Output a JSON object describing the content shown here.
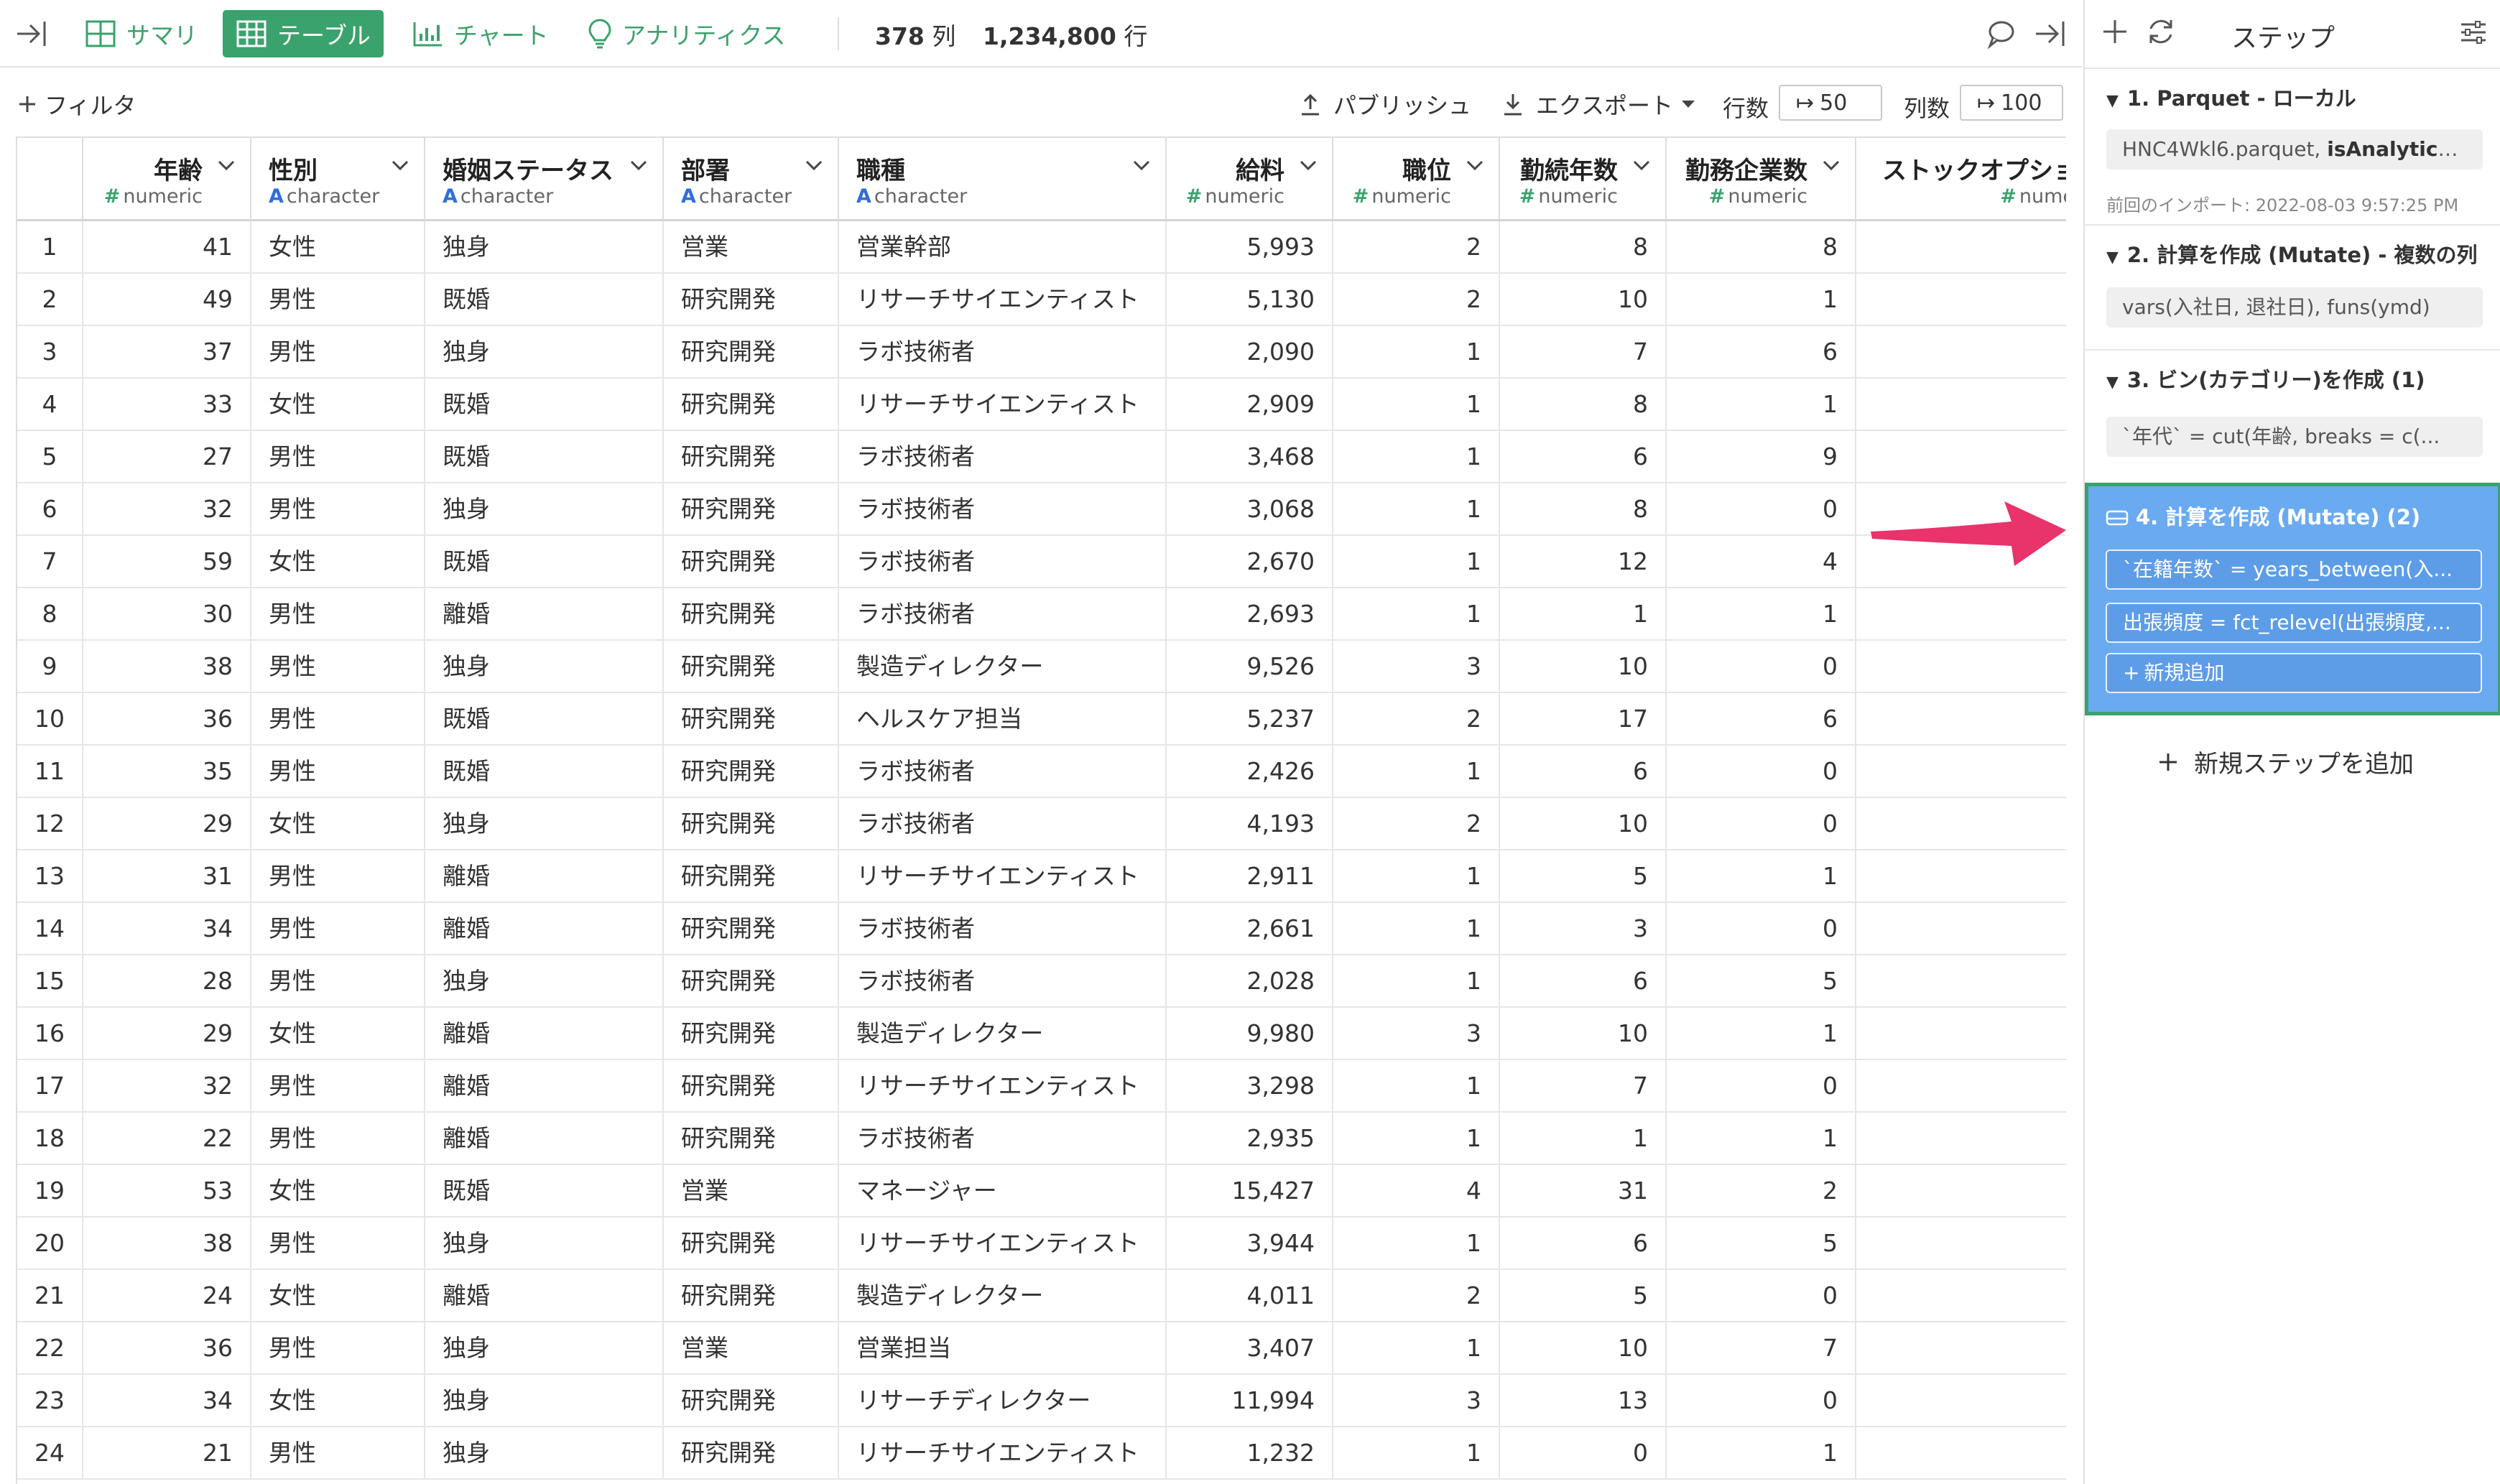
{
  "toolbar": {
    "tabs": [
      {
        "label": "サマリ",
        "icon": "summary-grid-icon",
        "active": false
      },
      {
        "label": "テーブル",
        "icon": "table-icon",
        "active": true
      },
      {
        "label": "チャート",
        "icon": "bar-chart-icon",
        "active": false
      },
      {
        "label": "アナリティクス",
        "icon": "lightbulb-icon",
        "active": false
      }
    ],
    "columns_count": "378",
    "columns_unit": "列",
    "rows_count": "1,234,800",
    "rows_unit": "行"
  },
  "subbar": {
    "filter_label": "フィルタ",
    "publish_label": "パブリッシュ",
    "export_label": "エクスポート",
    "rows_label": "行数",
    "rows_value": "50",
    "cols_label": "列数",
    "cols_value": "100"
  },
  "table": {
    "columns": [
      {
        "name": "年齢",
        "type": "numeric",
        "kind": "num"
      },
      {
        "name": "性別",
        "type": "character",
        "kind": "chr"
      },
      {
        "name": "婚姻ステータス",
        "type": "character",
        "kind": "chr"
      },
      {
        "name": "部署",
        "type": "character",
        "kind": "chr"
      },
      {
        "name": "職種",
        "type": "character",
        "kind": "chr"
      },
      {
        "name": "給料",
        "type": "numeric",
        "kind": "num"
      },
      {
        "name": "職位",
        "type": "numeric",
        "kind": "num"
      },
      {
        "name": "勤続年数",
        "type": "numeric",
        "kind": "num"
      },
      {
        "name": "勤務企業数",
        "type": "numeric",
        "kind": "num"
      },
      {
        "name": "ストックオプショ",
        "type": "nume",
        "kind": "num"
      }
    ],
    "rows": [
      [
        "1",
        "41",
        "女性",
        "独身",
        "営業",
        "営業幹部",
        "5,993",
        "2",
        "8",
        "8",
        ""
      ],
      [
        "2",
        "49",
        "男性",
        "既婚",
        "研究開発",
        "リサーチサイエンティスト",
        "5,130",
        "2",
        "10",
        "1",
        ""
      ],
      [
        "3",
        "37",
        "男性",
        "独身",
        "研究開発",
        "ラボ技術者",
        "2,090",
        "1",
        "7",
        "6",
        ""
      ],
      [
        "4",
        "33",
        "女性",
        "既婚",
        "研究開発",
        "リサーチサイエンティスト",
        "2,909",
        "1",
        "8",
        "1",
        ""
      ],
      [
        "5",
        "27",
        "男性",
        "既婚",
        "研究開発",
        "ラボ技術者",
        "3,468",
        "1",
        "6",
        "9",
        ""
      ],
      [
        "6",
        "32",
        "男性",
        "独身",
        "研究開発",
        "ラボ技術者",
        "3,068",
        "1",
        "8",
        "0",
        ""
      ],
      [
        "7",
        "59",
        "女性",
        "既婚",
        "研究開発",
        "ラボ技術者",
        "2,670",
        "1",
        "12",
        "4",
        ""
      ],
      [
        "8",
        "30",
        "男性",
        "離婚",
        "研究開発",
        "ラボ技術者",
        "2,693",
        "1",
        "1",
        "1",
        ""
      ],
      [
        "9",
        "38",
        "男性",
        "独身",
        "研究開発",
        "製造ディレクター",
        "9,526",
        "3",
        "10",
        "0",
        ""
      ],
      [
        "10",
        "36",
        "男性",
        "既婚",
        "研究開発",
        "ヘルスケア担当",
        "5,237",
        "2",
        "17",
        "6",
        ""
      ],
      [
        "11",
        "35",
        "男性",
        "既婚",
        "研究開発",
        "ラボ技術者",
        "2,426",
        "1",
        "6",
        "0",
        ""
      ],
      [
        "12",
        "29",
        "女性",
        "独身",
        "研究開発",
        "ラボ技術者",
        "4,193",
        "2",
        "10",
        "0",
        ""
      ],
      [
        "13",
        "31",
        "男性",
        "離婚",
        "研究開発",
        "リサーチサイエンティスト",
        "2,911",
        "1",
        "5",
        "1",
        ""
      ],
      [
        "14",
        "34",
        "男性",
        "離婚",
        "研究開発",
        "ラボ技術者",
        "2,661",
        "1",
        "3",
        "0",
        ""
      ],
      [
        "15",
        "28",
        "男性",
        "独身",
        "研究開発",
        "ラボ技術者",
        "2,028",
        "1",
        "6",
        "5",
        ""
      ],
      [
        "16",
        "29",
        "女性",
        "離婚",
        "研究開発",
        "製造ディレクター",
        "9,980",
        "3",
        "10",
        "1",
        ""
      ],
      [
        "17",
        "32",
        "男性",
        "離婚",
        "研究開発",
        "リサーチサイエンティスト",
        "3,298",
        "1",
        "7",
        "0",
        ""
      ],
      [
        "18",
        "22",
        "男性",
        "離婚",
        "研究開発",
        "ラボ技術者",
        "2,935",
        "1",
        "1",
        "1",
        ""
      ],
      [
        "19",
        "53",
        "女性",
        "既婚",
        "営業",
        "マネージャー",
        "15,427",
        "4",
        "31",
        "2",
        ""
      ],
      [
        "20",
        "38",
        "男性",
        "独身",
        "研究開発",
        "リサーチサイエンティスト",
        "3,944",
        "1",
        "6",
        "5",
        ""
      ],
      [
        "21",
        "24",
        "女性",
        "離婚",
        "研究開発",
        "製造ディレクター",
        "4,011",
        "2",
        "5",
        "0",
        ""
      ],
      [
        "22",
        "36",
        "男性",
        "独身",
        "営業",
        "営業担当",
        "3,407",
        "1",
        "10",
        "7",
        ""
      ],
      [
        "23",
        "34",
        "女性",
        "独身",
        "研究開発",
        "リサーチディレクター",
        "11,994",
        "3",
        "13",
        "0",
        ""
      ],
      [
        "24",
        "21",
        "男性",
        "独身",
        "研究開発",
        "リサーチサイエンティスト",
        "1,232",
        "1",
        "0",
        "1",
        ""
      ]
    ]
  },
  "steps": {
    "title": "ステップ",
    "items": [
      {
        "title": "1. Parquet - ローカル",
        "boxes": [
          "HNC4Wkl6.parquet, |isAnalyticsRD..."
        ],
        "note": "前回のインポート: 2022-08-03 9:57:25 PM"
      },
      {
        "title": "2. 計算を作成 (Mutate) - 複数の列",
        "boxes": [
          "vars(入社日, 退社日), funs(ymd)"
        ]
      },
      {
        "title": "3. ビン(カテゴリー)を作成 (1)",
        "boxes": [
          "`年代` = cut(年齢, breaks = c(..."
        ]
      },
      {
        "title": "4. 計算を作成 (Mutate) (2)",
        "boxes": [
          "`在籍年数` = years_between(入...",
          "出張頻度 = fct_relevel(出張頻度,..."
        ],
        "add_label": "新規追加",
        "active": true
      }
    ],
    "new_step_label": "新規ステップを追加"
  },
  "colors": {
    "accent": "#3aa26c",
    "active_step": "#6aaaf0",
    "arrow": "#e8336b"
  }
}
